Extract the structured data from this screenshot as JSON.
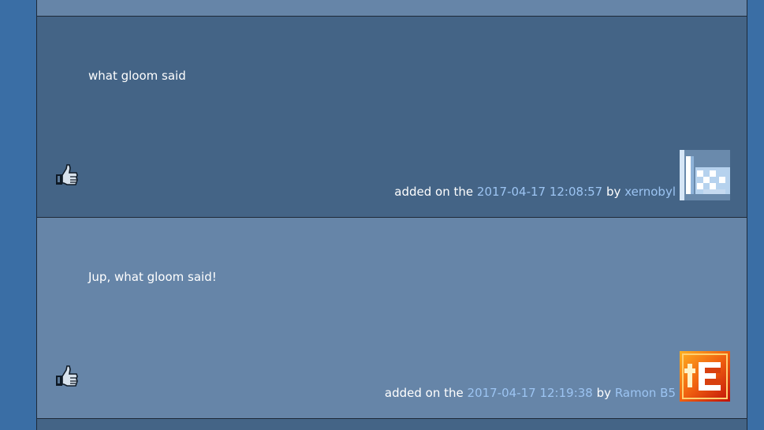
{
  "comments": [
    {
      "text": "what gloom said",
      "added_prefix": "added on the",
      "date": "2017-04-17 12:08:57",
      "by_word": "by",
      "author": "xernobyl",
      "avatar_icon": "xernobyl-avatar-icon",
      "thumb_icon": "thumbs-up-icon"
    },
    {
      "text": "Jup, what gloom said!",
      "added_prefix": "added on the",
      "date": "2017-04-17 12:19:38",
      "by_word": "by",
      "author": "Ramon B5",
      "avatar_icon": "ramon-b5-avatar-icon",
      "thumb_icon": "thumbs-up-icon"
    }
  ],
  "colors": {
    "page_background": "#3a6ea5",
    "comment_dark": "#446486",
    "comment_light": "#6685a8",
    "link": "#9cc4f2",
    "text": "#ffffff"
  }
}
